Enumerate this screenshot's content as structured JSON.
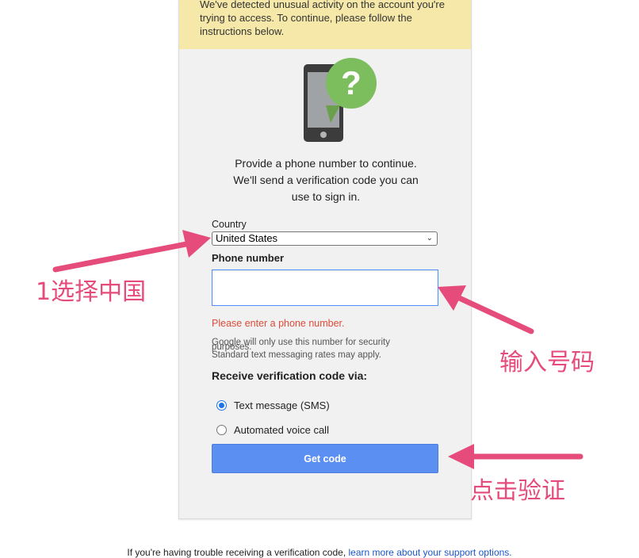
{
  "warning": {
    "text": "We've detected unusual activity on the account you're trying to access. To continue, please follow the instructions below."
  },
  "intro": {
    "line1": "Provide a phone number to continue.",
    "line2": "We'll send a verification code you can",
    "line3": "use to sign in."
  },
  "country": {
    "label": "Country",
    "selected": "United States"
  },
  "phone": {
    "label": "Phone number",
    "value": "",
    "error": "Please enter a phone number."
  },
  "notes": {
    "usage_a": "Google will only use this number for security",
    "usage_b": "purposes.",
    "rates": "Standard text messaging rates may apply."
  },
  "receive": {
    "label": "Receive verification code via:",
    "options": [
      "Text message (SMS)",
      "Automated voice call"
    ],
    "selected": "Text message (SMS)"
  },
  "button": {
    "label": "Get code"
  },
  "footer": {
    "text": "If you're having trouble receiving a verification code,",
    "link": "learn more about your support options."
  },
  "annotations": {
    "select_china": "1选择中国",
    "enter_number": "输入号码",
    "click_verify": "点击验证"
  },
  "colors": {
    "warning_bg": "#f5e8a8",
    "accent": "#5b8ff2",
    "error": "#dd4b39",
    "annotation": "#e54c7b",
    "question_badge": "#7cbd5e"
  },
  "icons": {
    "phone_illustration": "phone-question-icon",
    "select_chevron": "chevron-down-icon"
  }
}
